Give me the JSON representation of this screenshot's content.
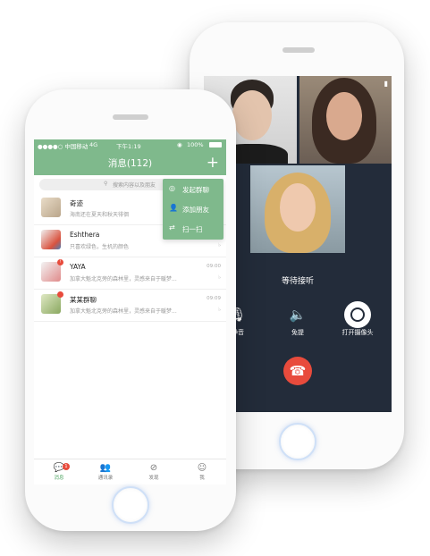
{
  "status_bar": {
    "carrier": "●●●●○ 中国移动",
    "network": "4G",
    "time": "下午1:19",
    "battery": "100%"
  },
  "nav": {
    "title": "消息(112)",
    "add_label": "+"
  },
  "search": {
    "placeholder": "搜索内容以及朋友"
  },
  "popup_menu": [
    {
      "label": "发起群聊",
      "icon": "chat-bubble-icon"
    },
    {
      "label": "添加朋友",
      "icon": "add-person-icon"
    },
    {
      "label": "扫一扫",
      "icon": "scan-icon"
    }
  ],
  "chats": [
    {
      "name": "奇迹",
      "preview": "海南还在夏天和秋天徘徊",
      "time": "",
      "unread": false
    },
    {
      "name": "Eshthera",
      "preview": "只喜欢绿色，生机的颜色",
      "time": "",
      "unread": false
    },
    {
      "name": "YAYA",
      "preview": "加拿大魁北克旁的森林里，灵感来自于暖梦...",
      "time": "09:00",
      "unread": true
    },
    {
      "name": "某某群聊",
      "preview": "加拿大魁北克旁的森林里，灵感来自于暖梦...",
      "time": "09:09",
      "unread": true
    }
  ],
  "tabs": [
    {
      "label": "消息",
      "icon": "message-icon",
      "badge": "1",
      "active": true
    },
    {
      "label": "通讯录",
      "icon": "contacts-icon",
      "active": false
    },
    {
      "label": "发现",
      "icon": "discover-icon",
      "active": false
    },
    {
      "label": "我",
      "icon": "profile-icon",
      "active": false
    }
  ],
  "call": {
    "status": "等待接听",
    "controls": [
      {
        "label": "静音",
        "icon": "mute-icon"
      },
      {
        "label": "免提",
        "icon": "speaker-icon"
      },
      {
        "label": "打开摄像头",
        "icon": "camera-icon"
      }
    ],
    "hangup_icon": "hang-up-icon"
  },
  "colors": {
    "brand_green": "#7fb98c",
    "call_background": "#232c3a",
    "hangup_red": "#e84b3c"
  }
}
